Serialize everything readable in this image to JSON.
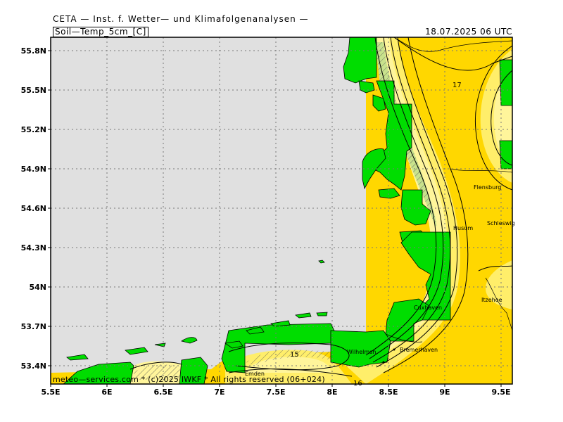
{
  "header": {
    "title": "CETA — Inst. f. Wetter— und Klimafolgenanalysen —",
    "parameter": "Soil—Temp_5cm_[C]",
    "datetime": "18.07.2025 06 UTC"
  },
  "footer": {
    "credit": "meteo—services.com * (c)2025 IWKF * All rights reserved (06+024)"
  },
  "axes": {
    "lon_labels": [
      "5.5E",
      "6E",
      "6.5E",
      "7E",
      "7.5E",
      "8E",
      "8.5E",
      "9E",
      "9.5E"
    ],
    "lat_labels": [
      "55.8N",
      "55.5N",
      "55.2N",
      "54.9N",
      "54.6N",
      "54.3N",
      "54N",
      "53.7N",
      "53.4N"
    ]
  },
  "places": {
    "flensburg": "Flensburg",
    "schleswig": "Schleswig",
    "husum": "Husum",
    "itzehoe": "Itzehoe",
    "cuxhaven": "Cuxhaven",
    "bremerhaven": "Bremerhaven",
    "wilhelmsh": "Wilhelmsh.",
    "emden": "Emden"
  },
  "contours": {
    "label_17": "17",
    "label_15": "15",
    "label_16": "16"
  },
  "colors": {
    "sea": "#e0e0e0",
    "land_no_data": "#00dd00",
    "temp_17_plus": "#ffd700",
    "temp_16": "#ffee6a",
    "temp_15": "#fff59b",
    "temp_14": "#c8e28c",
    "contour": "#000000"
  }
}
